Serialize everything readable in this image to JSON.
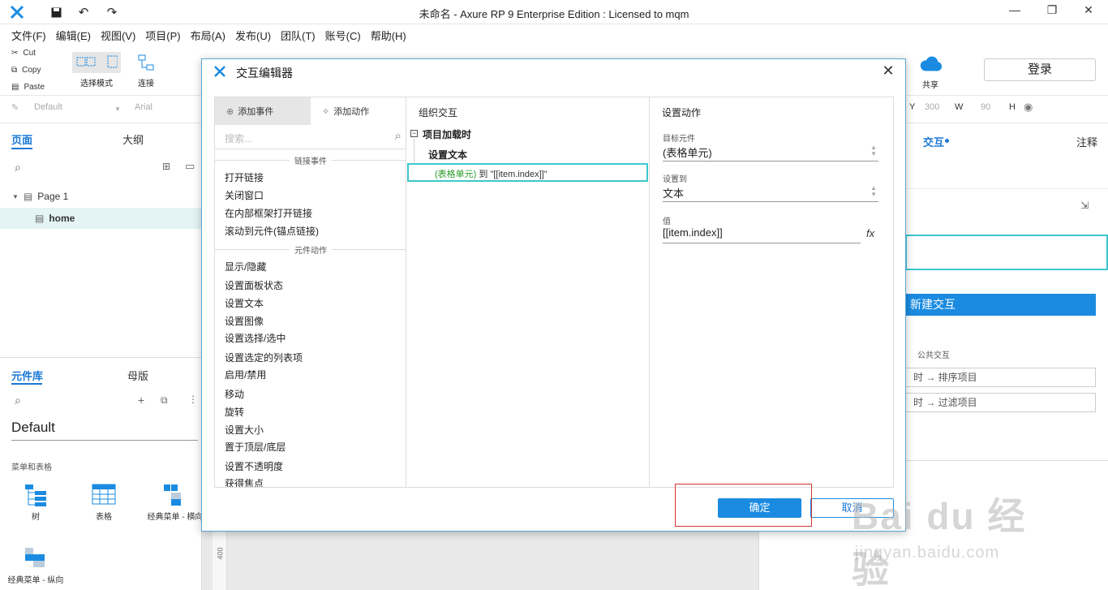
{
  "window": {
    "title": "未命名 - Axure RP 9 Enterprise Edition : Licensed to mqm"
  },
  "menu": [
    "文件(F)",
    "编辑(E)",
    "视图(V)",
    "项目(P)",
    "布局(A)",
    "发布(U)",
    "团队(T)",
    "账号(C)",
    "帮助(H)"
  ],
  "toolbar": {
    "cut": "Cut",
    "copy": "Copy",
    "paste": "Paste",
    "select_mode": "选择模式",
    "connect": "连接",
    "share": "共享",
    "login": "登录"
  },
  "stylebar": {
    "style": "Default",
    "font": "Arial",
    "y_label": "Y",
    "y_value": "300",
    "w_label": "W",
    "w_value": "90",
    "h_label": "H"
  },
  "pages_panel": {
    "tab_pages": "页面",
    "tab_outline": "大纲",
    "page1": "Page 1",
    "home": "home"
  },
  "library_panel": {
    "tab_library": "元件库",
    "tab_masters": "母版",
    "library_name": "Default",
    "category": "菜单和表格",
    "items": [
      "树",
      "表格",
      "经典菜单 - 横向",
      "经典菜单 - 纵向"
    ]
  },
  "right_panel": {
    "tab_interaction": "交互",
    "tab_notes": "注释",
    "new_interaction": "新建交互",
    "common_label": "公共交互",
    "common_1": "时 → 排序项目",
    "common_2": "时 → 过滤项目"
  },
  "ruler": {
    "mark": "400"
  },
  "dialog": {
    "title": "交互编辑器",
    "tab_add_event": "添加事件",
    "tab_add_action": "添加动作",
    "search_placeholder": "搜索...",
    "section_link": "链接事件",
    "link_actions": [
      "打开链接",
      "关闭窗口",
      "在内部框架打开链接",
      "滚动到元件(锚点链接)"
    ],
    "section_widget": "元件动作",
    "widget_actions": [
      "显示/隐藏",
      "设置面板状态",
      "设置文本",
      "设置图像",
      "设置选择/选中",
      "设置选定的列表项",
      "启用/禁用",
      "移动",
      "旋转",
      "设置大小",
      "置于顶层/底层",
      "设置不透明度",
      "获得焦点"
    ],
    "organize_title": "组织交互",
    "event_name": "项目加载时",
    "action_name": "设置文本",
    "action_target": "(表格单元)",
    "action_to": "到",
    "action_value": "\"[[item.index]]\"",
    "settings_title": "设置动作",
    "target_label": "目标元件",
    "target_value": "(表格单元)",
    "setto_label": "设置到",
    "setto_value": "文本",
    "value_label": "值",
    "value_value": "[[item.index]]",
    "fx": "fx",
    "ok": "确定",
    "cancel": "取消"
  },
  "watermark": {
    "brand": "Bai du 经验",
    "url": "jingyan.baidu.com"
  }
}
